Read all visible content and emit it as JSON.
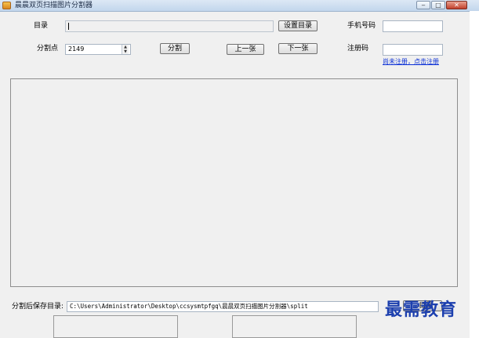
{
  "window": {
    "title": "晨晨双页扫描图片分割器"
  },
  "form": {
    "dir_label": "目录",
    "dir_value": "",
    "set_dir_button": "设置目录",
    "phone_label": "手机号码",
    "phone_value": "",
    "split_point_label": "分割点",
    "split_point_value": "2149",
    "split_button": "分割",
    "prev_button": "上一张",
    "next_button": "下一张",
    "reg_code_label": "注册码",
    "reg_code_value": "",
    "register_link": "尚未注册，点击注册"
  },
  "footer": {
    "save_dir_label": "分割后保存目录:",
    "save_dir_value": "C:\\Users\\Administrator\\Desktop\\ccsysmtpfgq\\晨晨双页扫描图片分割器\\split",
    "save_dir_button": "...目录"
  },
  "watermark": "最需教育"
}
